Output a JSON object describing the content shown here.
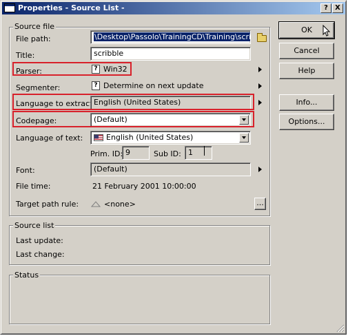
{
  "window": {
    "title": "Properties - Source List -",
    "help_glyph": "?",
    "close_glyph": "X"
  },
  "source_file": {
    "group_label": "Source file",
    "file_path_label": "File path:",
    "file_path_value": "\\Desktop\\Passolo\\TrainingCD\\Training\\scribble.exe",
    "title_label": "Title:",
    "title_value": "scribble",
    "parser_label": "Parser:",
    "parser_value": "Win32",
    "segmenter_label": "Segmenter:",
    "segmenter_value": "Determine on next update",
    "language_extract_label": "Language to extract:",
    "language_extract_value": "English (United States)",
    "codepage_label": "Codepage:",
    "codepage_value": "(Default)",
    "language_text_label": "Language of text:",
    "language_text_value": "English (United States)",
    "prim_id_label": "Prim. ID:",
    "prim_id_value": "9",
    "sub_id_label": "Sub ID:",
    "sub_id_value": "1",
    "font_label": "Font:",
    "font_value": "(Default)",
    "file_time_label": "File time:",
    "file_time_value": "21 February 2001 10:00:00",
    "target_path_label": "Target path rule:",
    "target_path_value": "<none>",
    "browse_label": "..."
  },
  "source_list": {
    "group_label": "Source list",
    "last_update_label": "Last update:",
    "last_change_label": "Last change:"
  },
  "status": {
    "group_label": "Status"
  },
  "buttons": {
    "ok": "OK",
    "cancel": "Cancel",
    "help": "Help",
    "info": "Info...",
    "options": "Options..."
  },
  "colors": {
    "highlight_border": "#d8202a",
    "titlebar_start": "#0a246a",
    "titlebar_end": "#a6caf0",
    "dialog_face": "#d4d0c8"
  }
}
